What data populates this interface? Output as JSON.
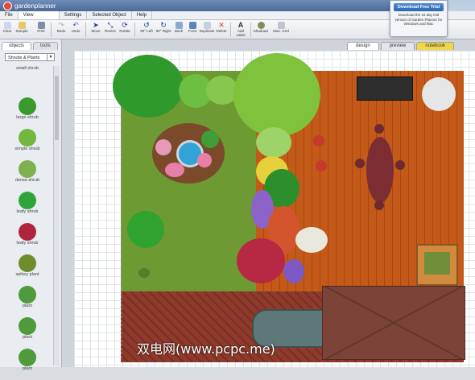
{
  "app": {
    "logo": "gardenplanner"
  },
  "menubar": {
    "items": [
      "File",
      "View",
      "Settings",
      "Selected Object",
      "Help"
    ],
    "active": "View"
  },
  "toolbar": {
    "buttons": [
      {
        "label": "Clear",
        "icon": "clear-icon"
      },
      {
        "label": "Sample",
        "icon": "sample-icon"
      },
      {
        "label": "Print",
        "icon": "print-icon"
      },
      {
        "label": "Redo",
        "icon": "redo-icon"
      },
      {
        "label": "Undo",
        "icon": "undo-icon"
      },
      {
        "label": "Move",
        "icon": "move-icon"
      },
      {
        "label": "Resize",
        "icon": "resize-icon"
      },
      {
        "label": "Rotate",
        "icon": "rotate-icon"
      },
      {
        "label": "90° Left",
        "icon": "rotate-left-icon"
      },
      {
        "label": "90° Right",
        "icon": "rotate-right-icon"
      },
      {
        "label": "Back",
        "icon": "back-icon"
      },
      {
        "label": "Front",
        "icon": "front-icon"
      },
      {
        "label": "Duplicate",
        "icon": "duplicate-icon"
      },
      {
        "label": "Delete",
        "icon": "delete-icon"
      },
      {
        "label": "Add Label",
        "icon": "add-label-icon"
      },
      {
        "label": "Shadows",
        "icon": "shadows-icon"
      },
      {
        "label": "Max. Grid",
        "icon": "max-grid-icon"
      }
    ]
  },
  "promo": {
    "button": "Download Free Trial",
    "text": "Download the 15 day trial version of Garden Planner for Windows and Mac"
  },
  "sidebar": {
    "tabs": [
      "objects",
      "tools"
    ],
    "category": "Shrubs & Plants",
    "items": [
      "small shrub",
      "large shrub",
      "simple shrub",
      "dense shrub",
      "leafy shrub",
      "leafy shrub",
      "spikey plant",
      "plant",
      "plant",
      "plant"
    ]
  },
  "view_tabs": [
    "design",
    "preview",
    "notebook"
  ],
  "colors": {
    "lawn": "#6e9a33",
    "deck": "#c45a19",
    "patio": "#8e3a2c",
    "roof": "#7c4438",
    "notebook_tab": "#f2d64a",
    "download_button": "#2f66b1"
  },
  "watermark": "双电网(www.pcpc.me)"
}
